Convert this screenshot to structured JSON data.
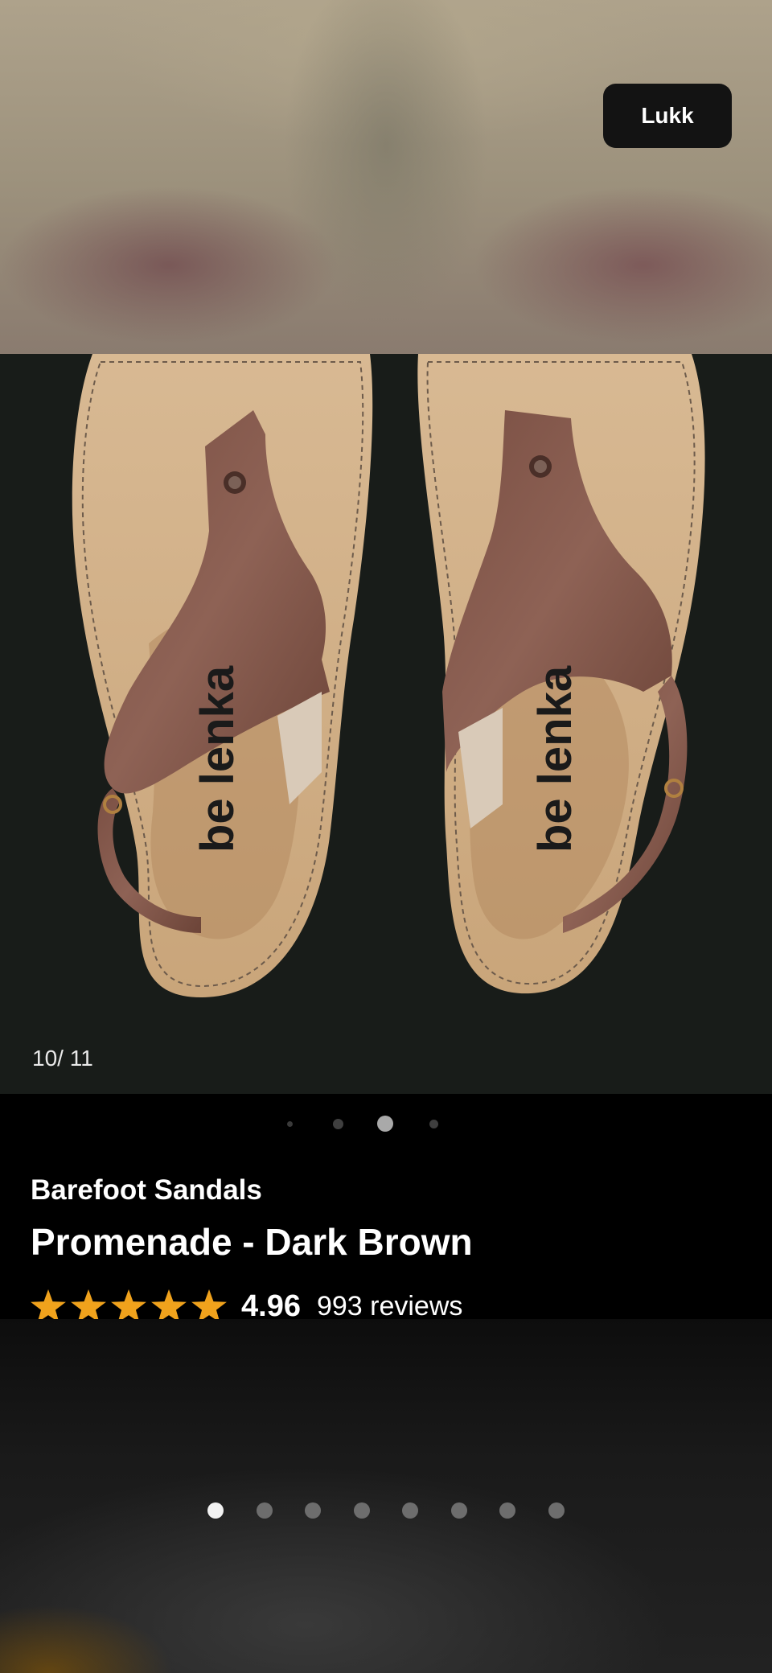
{
  "header": {
    "close_label": "Lukk"
  },
  "gallery": {
    "counter": "10/ 11",
    "dots": [
      {
        "state": "tiny"
      },
      {
        "state": "small"
      },
      {
        "state": "active"
      },
      {
        "state": "small"
      }
    ],
    "image_brand_print": "be lenka"
  },
  "product": {
    "category": "Barefoot Sandals",
    "title": "Promenade - Dark Brown",
    "rating": "4.96",
    "stars": 5,
    "reviews": "993 reviews"
  },
  "stories": {
    "count": 8,
    "active_index": 0
  },
  "colors": {
    "star": "#f0a21c",
    "close_bg": "#131313",
    "image_bg": "#181c19"
  }
}
